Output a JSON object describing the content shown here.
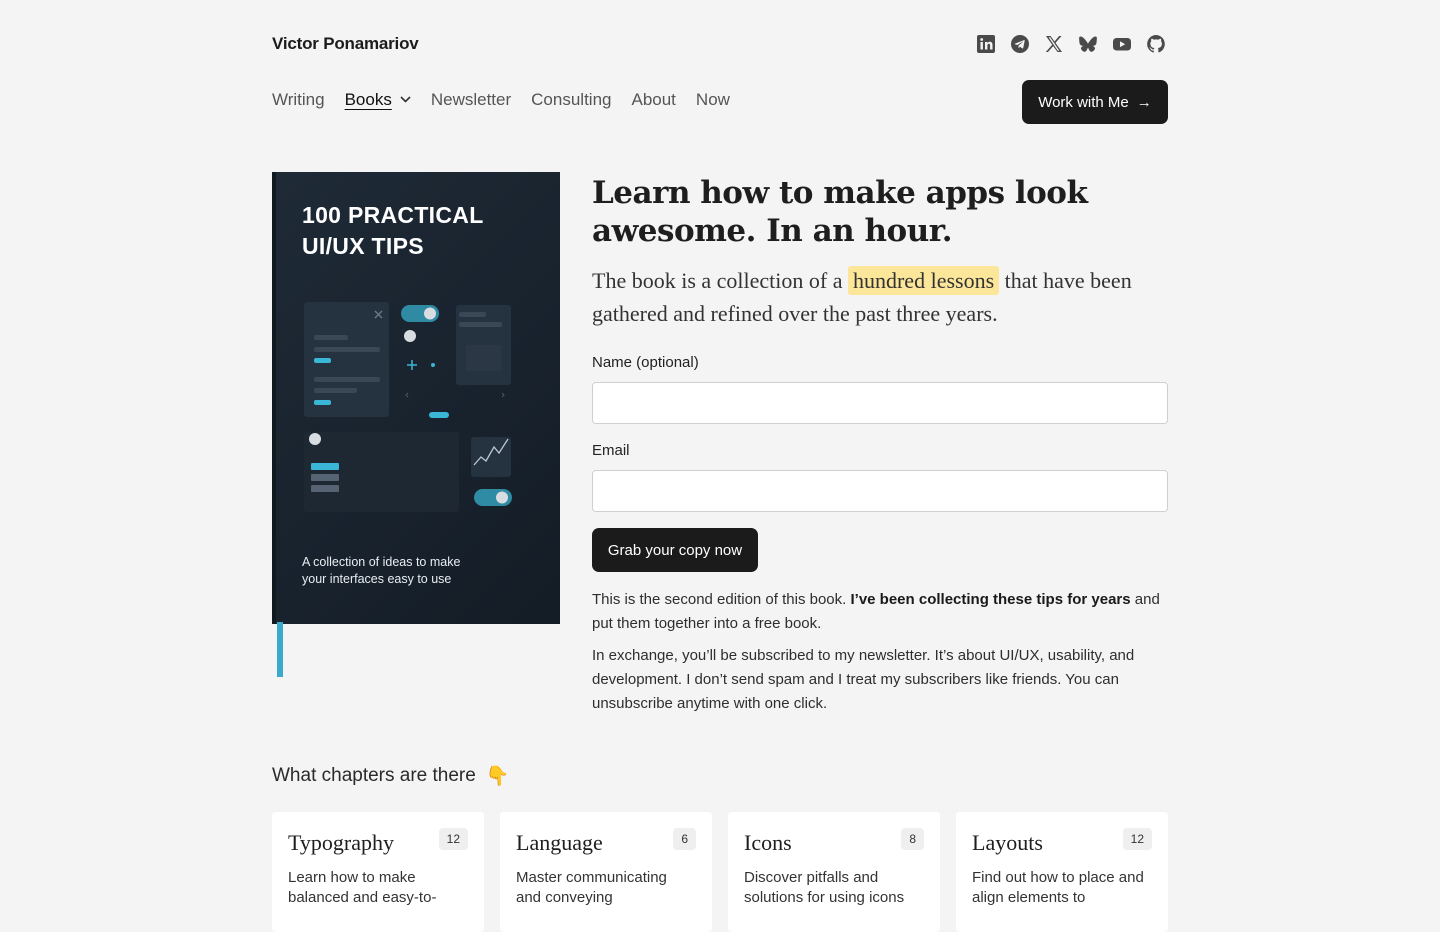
{
  "header": {
    "brand": "Victor Ponamariov",
    "socials": [
      "linkedin-icon",
      "telegram-icon",
      "x-icon",
      "bluesky-icon",
      "youtube-icon",
      "github-icon"
    ],
    "nav": [
      {
        "label": "Writing"
      },
      {
        "label": "Books",
        "active": true
      },
      {
        "label": "Newsletter"
      },
      {
        "label": "Consulting"
      },
      {
        "label": "About"
      },
      {
        "label": "Now"
      }
    ],
    "cta": "Work with Me",
    "cta_arrow": "→",
    "books_chevron": "⌄"
  },
  "book": {
    "title_line1": "100 PRACTICAL",
    "title_line2": "UI/UX TIPS",
    "subtitle_line1": "A collection of ideas to make",
    "subtitle_line2": "your interfaces easy to use",
    "accent": "#3aa9cc"
  },
  "hero": {
    "headline": "Learn how to make apps look awesome. In an hour.",
    "lede_before": "The book is a collection of a ",
    "lede_highlight": "hundred lessons",
    "lede_after": " that have been gathered and refined over the past three years.",
    "highlight_color": "#fce69a"
  },
  "form": {
    "name_label": "Name (optional)",
    "name_value": "",
    "email_label": "Email",
    "email_value": "",
    "submit": "Grab your copy now"
  },
  "notes": {
    "p1_before": "This is the second edition of this book. ",
    "p1_bold": "I’ve been collecting these tips for years",
    "p1_after": " and put them together into a free book.",
    "p2": "In exchange, you’ll be subscribed to my newsletter. It’s about UI/UX, usability, and development. I don’t send spam and I treat my subscribers like friends. You can unsubscribe anytime with one click."
  },
  "chapters": {
    "title": "What chapters are there",
    "emoji": "👇",
    "items": [
      {
        "name": "Typography",
        "count": "12",
        "desc": "Learn how to make balanced and easy-to-"
      },
      {
        "name": "Language",
        "count": "6",
        "desc": "Master communicating and conveying"
      },
      {
        "name": "Icons",
        "count": "8",
        "desc": "Discover pitfalls and solutions for using icons"
      },
      {
        "name": "Layouts",
        "count": "12",
        "desc": "Find out how to place and align elements to"
      }
    ]
  }
}
